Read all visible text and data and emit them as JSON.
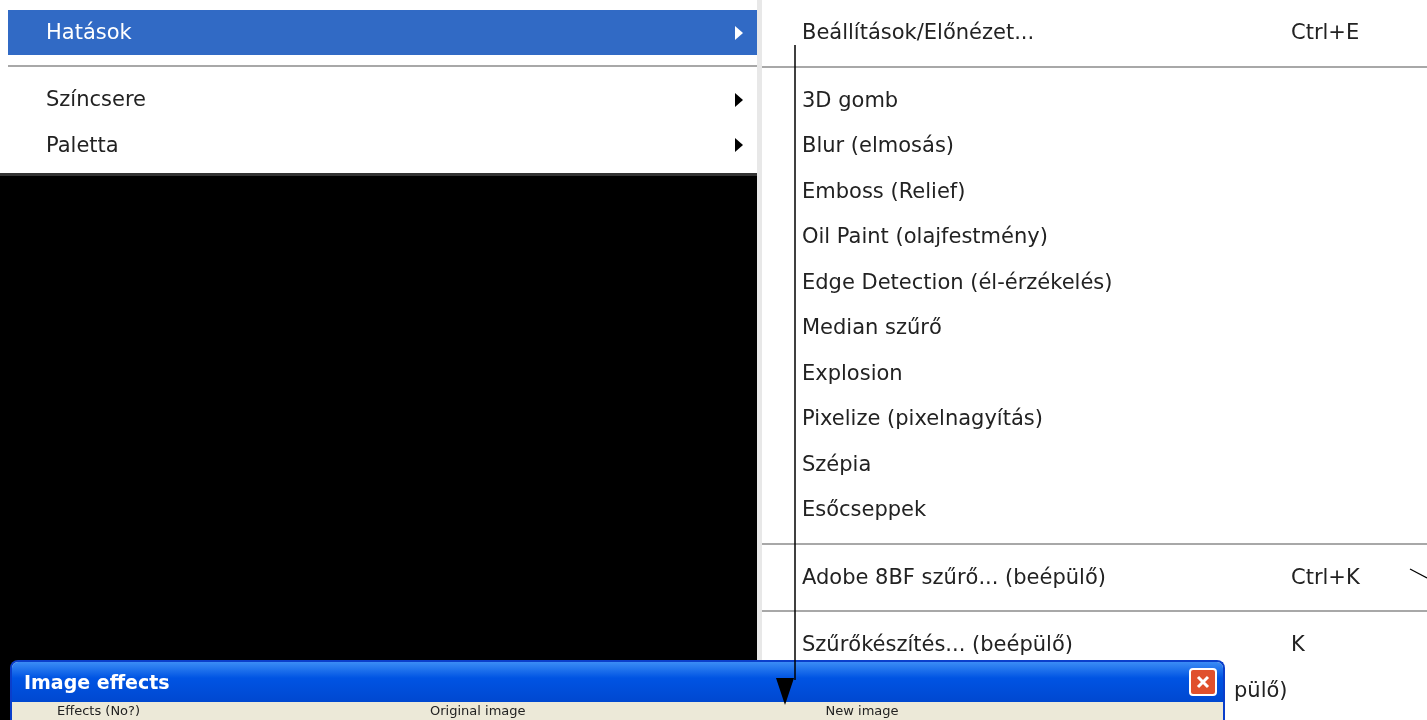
{
  "main_menu": {
    "items": [
      {
        "kind": "item",
        "label": "Hatások",
        "submenu": true,
        "selected": true
      },
      {
        "kind": "separator"
      },
      {
        "kind": "item",
        "label": "Színcsere",
        "submenu": true,
        "selected": false
      },
      {
        "kind": "item",
        "label": "Paletta",
        "submenu": true,
        "selected": false
      }
    ]
  },
  "effects_submenu": {
    "items": [
      {
        "kind": "item",
        "label": "Beállítások/Előnézet...",
        "shortcut": "Ctrl+E"
      },
      {
        "kind": "separator"
      },
      {
        "kind": "item",
        "label": "3D gomb"
      },
      {
        "kind": "item",
        "label": "Blur (elmosás)"
      },
      {
        "kind": "item",
        "label": "Emboss (Relief)"
      },
      {
        "kind": "item",
        "label": "Oil Paint (olajfestmény)"
      },
      {
        "kind": "item",
        "label": "Edge Detection (él-érzékelés)"
      },
      {
        "kind": "item",
        "label": "Median szűrő"
      },
      {
        "kind": "item",
        "label": "Explosion"
      },
      {
        "kind": "item",
        "label": "Pixelize (pixelnagyítás)"
      },
      {
        "kind": "item",
        "label": "Szépia"
      },
      {
        "kind": "item",
        "label": "Esőcseppek"
      },
      {
        "kind": "separator"
      },
      {
        "kind": "item",
        "label": "Adobe 8BF szűrő... (beépülő)",
        "shortcut": "Ctrl+K"
      },
      {
        "kind": "separator"
      },
      {
        "kind": "item",
        "label": "Szűrőkészítés... (beépülő)",
        "shortcut": "K"
      },
      {
        "kind": "covered",
        "label": "pülő)"
      }
    ]
  },
  "dialog": {
    "title": "Image effects",
    "columns": [
      "Effects (No?)",
      "Original image",
      "New image"
    ]
  }
}
